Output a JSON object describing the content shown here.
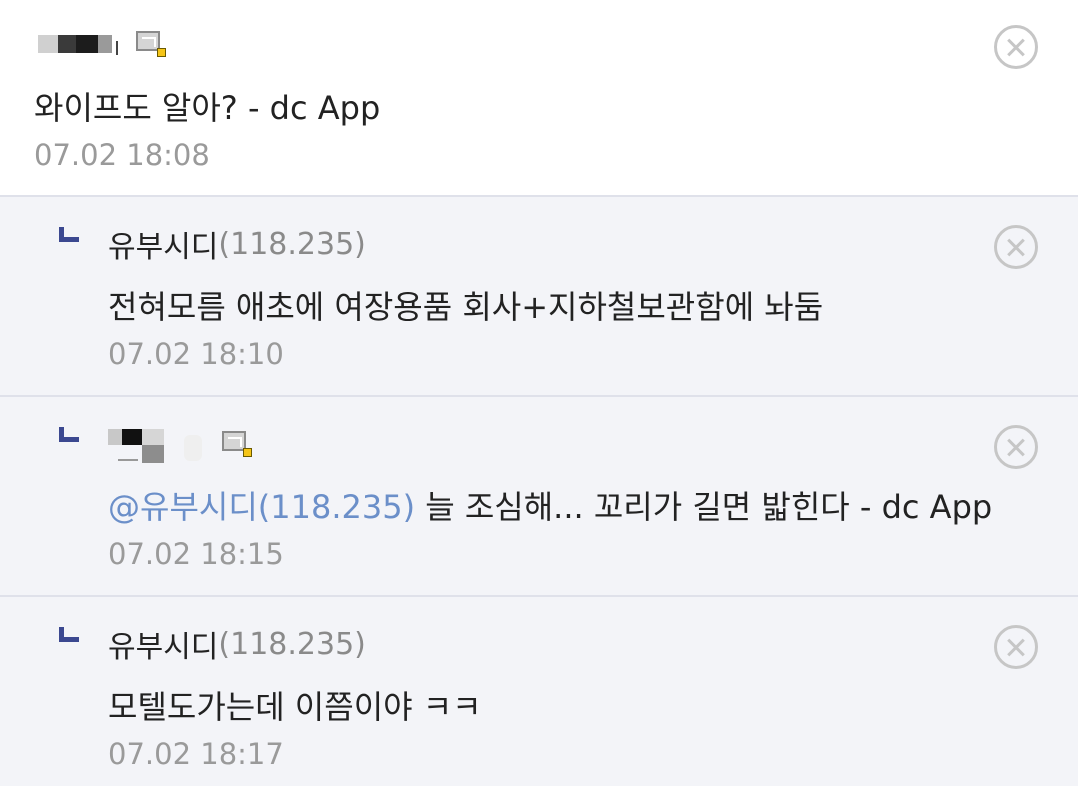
{
  "comments": [
    {
      "nickname": "",
      "ip": "",
      "content": "와이프도 알아? - dc App",
      "date": "07.02 18:08",
      "mobile_icon": "mobile-app-icon",
      "delete_icon": "close-circle-icon"
    },
    {
      "nickname": "유부시디",
      "ip": "(118.235)",
      "content": "전혀모름 애초에 여장용품 회사+지하철보관함에 놔둠",
      "date": "07.02 18:10",
      "reply_icon": "reply-arrow-icon",
      "delete_icon": "close-circle-icon"
    },
    {
      "nickname": "",
      "ip": "",
      "mention": "@유부시디(118.235)",
      "content": " 늘 조심해... 꼬리가 길면 밟힌다 - dc App",
      "date": "07.02 18:15",
      "mobile_icon": "mobile-app-icon",
      "reply_icon": "reply-arrow-icon",
      "delete_icon": "close-circle-icon"
    },
    {
      "nickname": "유부시디",
      "ip": "(118.235)",
      "content": "모텔도가는데 이쯤이야 ㅋㅋ",
      "date": "07.02 18:17",
      "reply_icon": "reply-arrow-icon",
      "delete_icon": "close-circle-icon"
    }
  ],
  "colors": {
    "reply_background": "#f3f4f8",
    "reply_arrow": "#3b4890",
    "mention": "#6b8fc9",
    "date": "#9a9a9a",
    "ip": "#8a8a8a"
  }
}
